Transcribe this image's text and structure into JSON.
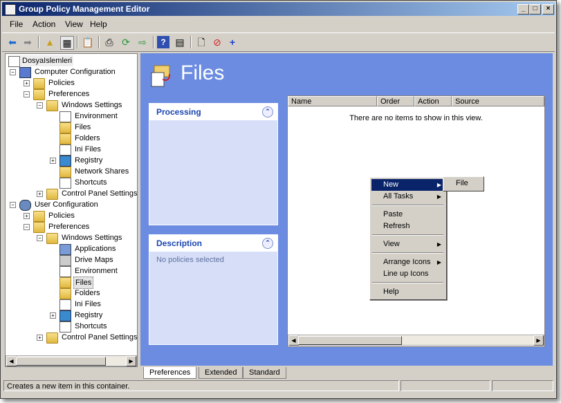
{
  "window": {
    "title": "Group Policy Management Editor"
  },
  "menu": [
    "File",
    "Action",
    "View",
    "Help"
  ],
  "tree": {
    "root": "DosyaIslemleri",
    "computer_config": "Computer Configuration",
    "policies": "Policies",
    "preferences": "Preferences",
    "windows_settings": "Windows Settings",
    "environment": "Environment",
    "files": "Files",
    "folders": "Folders",
    "ini_files": "Ini Files",
    "registry": "Registry",
    "network_shares": "Network Shares",
    "shortcuts": "Shortcuts",
    "control_panel": "Control Panel Settings",
    "user_config": "User Configuration",
    "applications": "Applications",
    "drive_maps": "Drive Maps"
  },
  "header": {
    "title": "Files"
  },
  "processing": {
    "title": "Processing"
  },
  "description": {
    "title": "Description",
    "text": "No policies selected"
  },
  "list": {
    "columns": [
      "Name",
      "Order",
      "Action",
      "Source"
    ],
    "empty_text": "There are no items to show in this view."
  },
  "context_menu": {
    "new": "New",
    "all_tasks": "All Tasks",
    "paste": "Paste",
    "refresh": "Refresh",
    "view": "View",
    "arrange_icons": "Arrange Icons",
    "line_up_icons": "Line up Icons",
    "help": "Help"
  },
  "submenu": {
    "file": "File"
  },
  "tabs": [
    "Preferences",
    "Extended",
    "Standard"
  ],
  "status": {
    "text": "Creates a new item in this container."
  },
  "colors": {
    "accent": "#0a246a",
    "panel_bg": "#6b8ce0"
  }
}
